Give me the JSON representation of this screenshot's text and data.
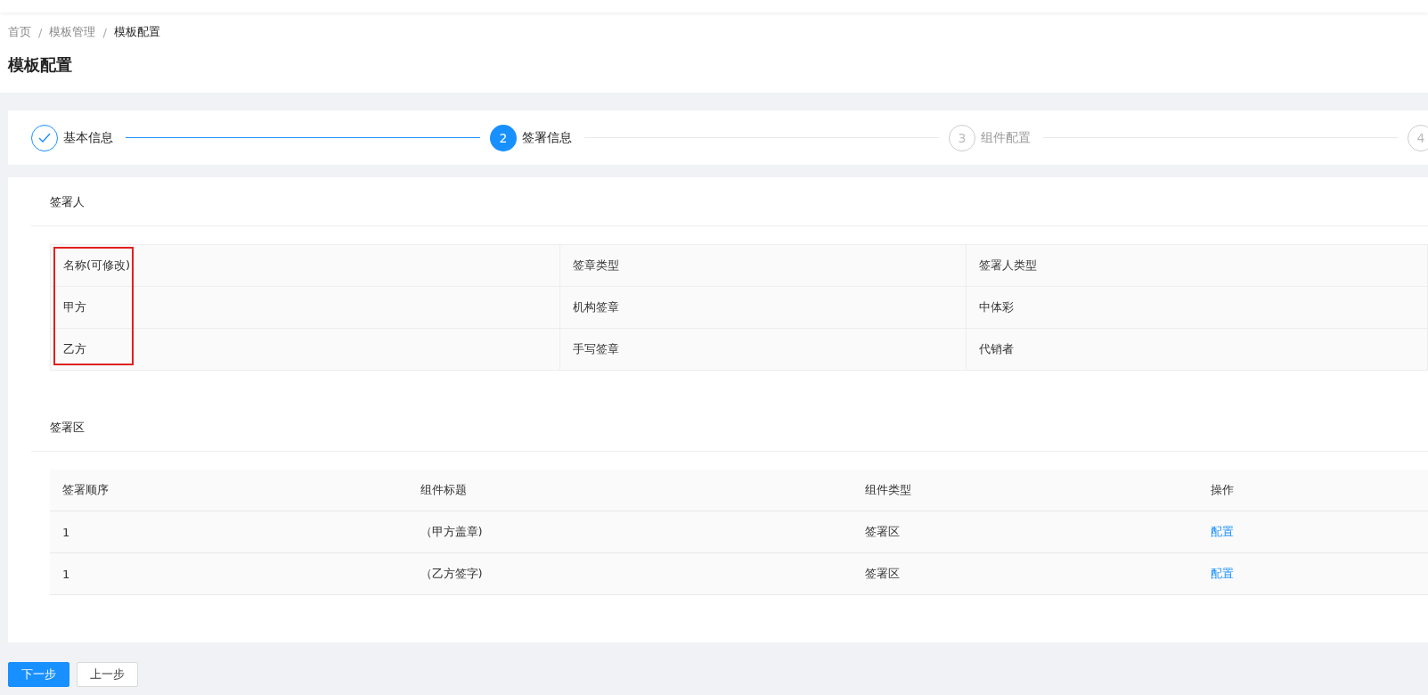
{
  "breadcrumb": [
    {
      "label": "首页",
      "current": false
    },
    {
      "label": "模板管理",
      "current": false
    },
    {
      "label": "模板配置",
      "current": true
    }
  ],
  "breadcrumb_separator": "/",
  "page_title": "模板配置",
  "steps": [
    {
      "title": "基本信息",
      "completed": true,
      "selected": false
    },
    {
      "number": "2",
      "title": "签署信息",
      "completed": false,
      "selected": true
    },
    {
      "number": "3",
      "title": "组件配置",
      "completed": false,
      "selected": false
    },
    {
      "number": "4",
      "completed": false,
      "selected": false
    }
  ],
  "signers": {
    "title": "签署人",
    "columns": [
      {
        "label": "名称(可修改)",
        "highlighted": true
      },
      {
        "label": "签章类型",
        "highlighted": false
      },
      {
        "label": "签署人类型",
        "highlighted": false
      }
    ],
    "rows": [
      [
        "甲方",
        "机构签章",
        "中体彩"
      ],
      [
        "乙方",
        "手写签章",
        "代销者"
      ]
    ]
  },
  "sign_zones": {
    "title": "签署区",
    "columns": [
      "签署顺序",
      "组件标题",
      "组件类型",
      "操作"
    ],
    "rows": [
      {
        "order": "1",
        "component_title": "（甲方盖章)",
        "component_type": "签署区",
        "action": "配置"
      },
      {
        "order": "1",
        "component_title": "（乙方签字)",
        "component_type": "签署区",
        "action": "配置"
      }
    ]
  },
  "buttons": [
    {
      "label": "下一步",
      "kind": "primary"
    },
    {
      "label": "上一步",
      "kind": "default"
    }
  ]
}
